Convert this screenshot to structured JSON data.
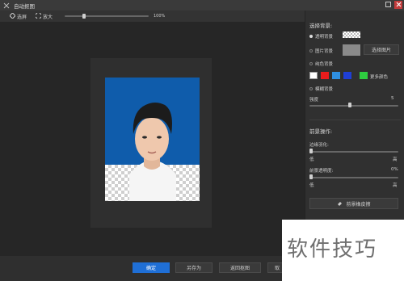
{
  "window": {
    "title": "自动抠图"
  },
  "toolbar": {
    "select_label": "选屏",
    "zoom_label": "放大",
    "zoom_value": "100%",
    "zoom_fraction": 0.22
  },
  "canvas": {
    "photo_background": "#0f5cab",
    "subject": "证件照人像"
  },
  "panel": {
    "bg_section_title": "选择背景:",
    "opt_transparent": "透明背景",
    "opt_image": "图片背景",
    "select_image_btn": "选择图片",
    "opt_solid": "纯色背景",
    "swatches": [
      "#ffffff",
      "#e81c1c",
      "#2f8fe0",
      "#1f3fd6",
      "#2ecc40"
    ],
    "more_colors_label": "更多颜色",
    "opt_blur": "模糊背景",
    "blur_label": "强度",
    "blur_value": "5",
    "blur_fraction": 0.45,
    "fg_section_title": "前景操作:",
    "edge_label": "边缘羽化:",
    "edge_low": "低",
    "edge_high": "高",
    "edge_fraction": 0.0,
    "opacity_label": "前景透明度:",
    "opacity_value": "0%",
    "opacity_low": "低",
    "opacity_high": "高",
    "opacity_fraction": 0.0,
    "erase_btn": "前景橡皮擦"
  },
  "bottom": {
    "ok": "确定",
    "save_as": "另存为",
    "back": "返回抠图",
    "cancel": "取"
  },
  "watermark": {
    "text": "软件技巧"
  }
}
